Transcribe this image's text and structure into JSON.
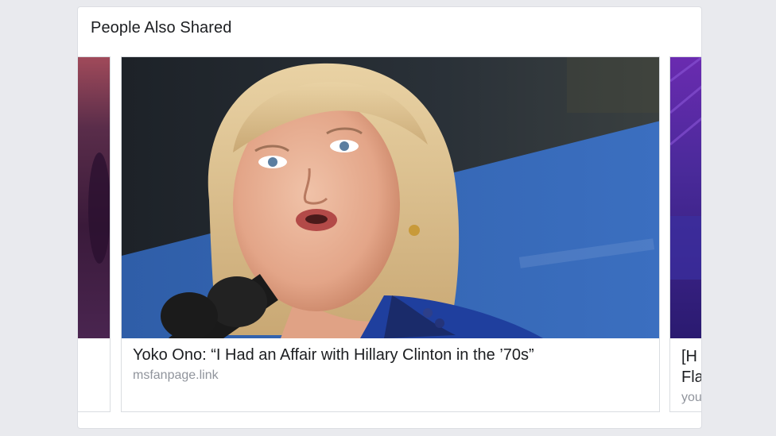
{
  "section": {
    "title": "People Also Shared"
  },
  "main_story": {
    "title": "Yoko Ono: “I Had an Affair with Hillary Clinton in the ’70s”",
    "domain": "msfanpage.link",
    "image": "photo-woman-speaking-at-microphones"
  },
  "next_story": {
    "title_line1": "[H",
    "title_line2": "Fla",
    "domain": "you"
  },
  "colors": {
    "page_background": "#e9eaee",
    "card_background": "#ffffff",
    "title_text": "#1c1e21",
    "domain_text": "#90949c"
  }
}
